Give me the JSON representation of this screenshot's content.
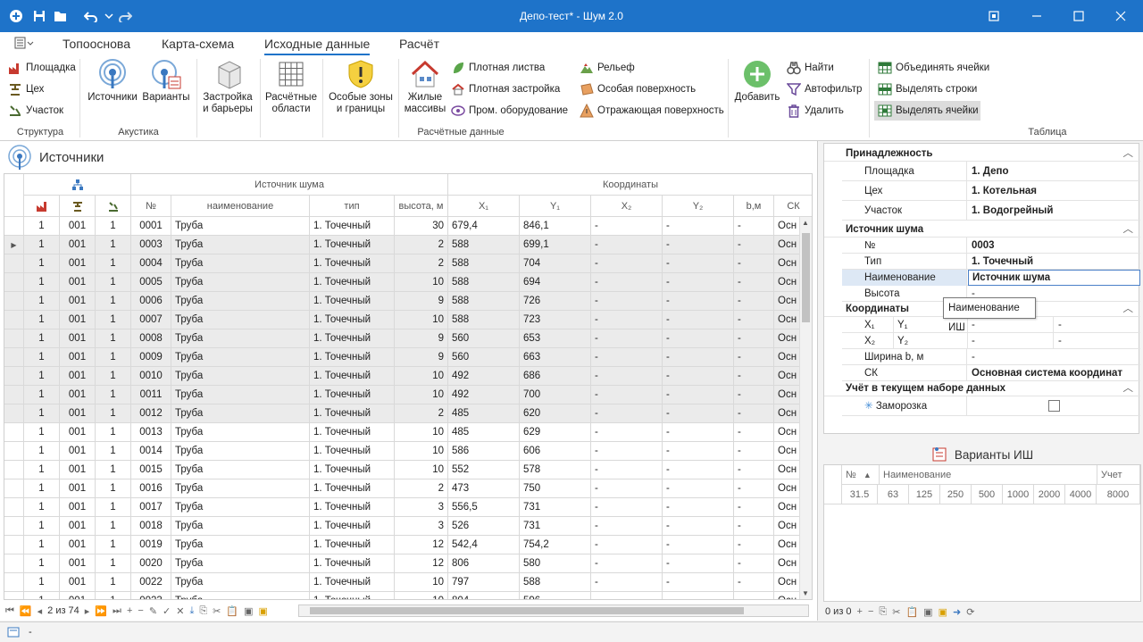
{
  "window": {
    "title": "Депо-тест* - Шум 2.0"
  },
  "menu": {
    "tabs": [
      "Топооснова",
      "Карта-схема",
      "Исходные данные",
      "Расчёт"
    ],
    "active_tab": "Исходные данные"
  },
  "ribbon": {
    "structure": {
      "items": [
        "Площадка",
        "Цех",
        "Участок"
      ],
      "group": "Структура"
    },
    "acoustics": {
      "sources": "Источники",
      "variants": "Варианты",
      "group": "Акустика"
    },
    "calc": {
      "buildings": "Застройка\nи барьеры",
      "areas": "Расчётные\nобласти",
      "zones": "Особые зоны\nи границы",
      "residential": "Жилые\nмассивы",
      "small1": [
        "Плотная листва",
        "Плотная застройка",
        "Пром. оборудование"
      ],
      "small2": [
        "Рельеф",
        "Особая поверхность",
        "Отражающая поверхность"
      ],
      "group": "Расчётные данные"
    },
    "table": {
      "add": "Добавить",
      "small1": [
        "Найти",
        "Автофильтр",
        "Удалить"
      ],
      "small2": [
        "Объединять ячейки",
        "Выделять строки",
        "Выделять ячейки"
      ],
      "group": "Таблица"
    }
  },
  "left": {
    "title": "Источники",
    "band_source": "Источник шума",
    "band_coords": "Координаты",
    "columns": [
      "№",
      "наименование",
      "тип",
      "высота, м",
      "X₁",
      "Y₁",
      "X₂",
      "Y₂",
      "b,м",
      "СК"
    ],
    "rows": [
      [
        "1",
        "001",
        "1",
        "0001",
        "Труба",
        "1. Точечный",
        "30",
        "679,4",
        "846,1",
        "-",
        "-",
        "-",
        "Осн"
      ],
      [
        "1",
        "001",
        "1",
        "0003",
        "Труба",
        "1. Точечный",
        "2",
        "588",
        "699,1",
        "-",
        "-",
        "-",
        "Осн"
      ],
      [
        "1",
        "001",
        "1",
        "0004",
        "Труба",
        "1. Точечный",
        "2",
        "588",
        "704",
        "-",
        "-",
        "-",
        "Осн"
      ],
      [
        "1",
        "001",
        "1",
        "0005",
        "Труба",
        "1. Точечный",
        "10",
        "588",
        "694",
        "-",
        "-",
        "-",
        "Осн"
      ],
      [
        "1",
        "001",
        "1",
        "0006",
        "Труба",
        "1. Точечный",
        "9",
        "588",
        "726",
        "-",
        "-",
        "-",
        "Осн"
      ],
      [
        "1",
        "001",
        "1",
        "0007",
        "Труба",
        "1. Точечный",
        "10",
        "588",
        "723",
        "-",
        "-",
        "-",
        "Осн"
      ],
      [
        "1",
        "001",
        "1",
        "0008",
        "Труба",
        "1. Точечный",
        "9",
        "560",
        "653",
        "-",
        "-",
        "-",
        "Осн"
      ],
      [
        "1",
        "001",
        "1",
        "0009",
        "Труба",
        "1. Точечный",
        "9",
        "560",
        "663",
        "-",
        "-",
        "-",
        "Осн"
      ],
      [
        "1",
        "001",
        "1",
        "0010",
        "Труба",
        "1. Точечный",
        "10",
        "492",
        "686",
        "-",
        "-",
        "-",
        "Осн"
      ],
      [
        "1",
        "001",
        "1",
        "0011",
        "Труба",
        "1. Точечный",
        "10",
        "492",
        "700",
        "-",
        "-",
        "-",
        "Осн"
      ],
      [
        "1",
        "001",
        "1",
        "0012",
        "Труба",
        "1. Точечный",
        "2",
        "485",
        "620",
        "-",
        "-",
        "-",
        "Осн"
      ],
      [
        "1",
        "001",
        "1",
        "0013",
        "Труба",
        "1. Точечный",
        "10",
        "485",
        "629",
        "-",
        "-",
        "-",
        "Осн"
      ],
      [
        "1",
        "001",
        "1",
        "0014",
        "Труба",
        "1. Точечный",
        "10",
        "586",
        "606",
        "-",
        "-",
        "-",
        "Осн"
      ],
      [
        "1",
        "001",
        "1",
        "0015",
        "Труба",
        "1. Точечный",
        "10",
        "552",
        "578",
        "-",
        "-",
        "-",
        "Осн"
      ],
      [
        "1",
        "001",
        "1",
        "0016",
        "Труба",
        "1. Точечный",
        "2",
        "473",
        "750",
        "-",
        "-",
        "-",
        "Осн"
      ],
      [
        "1",
        "001",
        "1",
        "0017",
        "Труба",
        "1. Точечный",
        "3",
        "556,5",
        "731",
        "-",
        "-",
        "-",
        "Осн"
      ],
      [
        "1",
        "001",
        "1",
        "0018",
        "Труба",
        "1. Точечный",
        "3",
        "526",
        "731",
        "-",
        "-",
        "-",
        "Осн"
      ],
      [
        "1",
        "001",
        "1",
        "0019",
        "Труба",
        "1. Точечный",
        "12",
        "542,4",
        "754,2",
        "-",
        "-",
        "-",
        "Осн"
      ],
      [
        "1",
        "001",
        "1",
        "0020",
        "Труба",
        "1. Точечный",
        "12",
        "806",
        "580",
        "-",
        "-",
        "-",
        "Осн"
      ],
      [
        "1",
        "001",
        "1",
        "0022",
        "Труба",
        "1. Точечный",
        "10",
        "797",
        "588",
        "-",
        "-",
        "-",
        "Осн"
      ],
      [
        "1",
        "001",
        "1",
        "0023",
        "Труба",
        "1. Точечный",
        "10",
        "804",
        "596",
        "-",
        "-",
        "-",
        "Осн"
      ]
    ],
    "nav_counter": "2 из 74"
  },
  "props": {
    "cat1": "Принадлежность",
    "p1": [
      [
        "Площадка",
        "1. Депо"
      ],
      [
        "Цех",
        "1. Котельная"
      ],
      [
        "Участок",
        "1. Водогрейный"
      ]
    ],
    "cat2": "Источник шума",
    "p2": [
      [
        "№",
        "0003"
      ],
      [
        "Тип",
        "1. Точечный"
      ],
      [
        "Наименование",
        "Источник шума"
      ],
      [
        "Высота",
        "-"
      ]
    ],
    "cat3": "Координаты",
    "x1": "X₁",
    "y1": "Y₁",
    "x2": "X₂",
    "y2": "Y₂",
    "dash": "-",
    "width_label": "Ширина b, м",
    "width_val": "-",
    "sk_label": "СК",
    "sk_val": "Основная система координат",
    "cat4": "Учёт в текущем наборе данных",
    "freeze": "Заморозка",
    "tooltip": "Наименование ИШ"
  },
  "variants": {
    "title": "Варианты ИШ",
    "col_no": "№",
    "col_name": "Наименование",
    "col_uchet": "Учет",
    "freqs": [
      "31.5",
      "63",
      "125",
      "250",
      "500",
      "1000",
      "2000",
      "4000",
      "8000"
    ],
    "counter": "0 из 0"
  },
  "status": {
    "text": "-"
  }
}
